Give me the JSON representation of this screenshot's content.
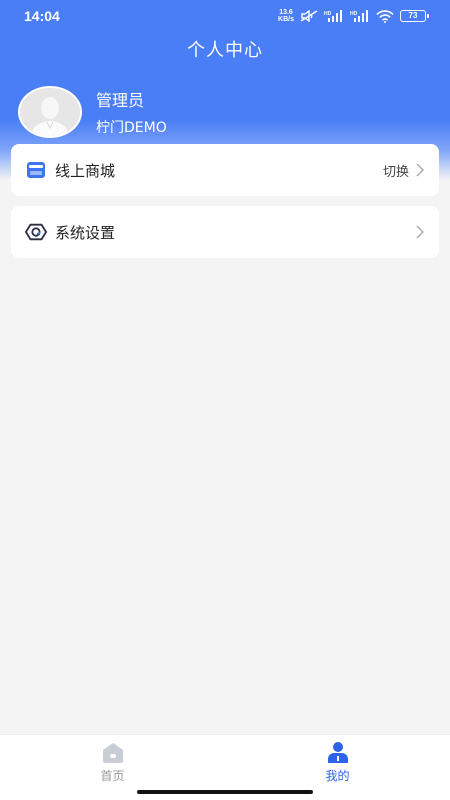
{
  "status_bar": {
    "time": "14:04",
    "net_speed_value": "13.6",
    "net_speed_unit": "KB/s",
    "battery": "73",
    "icons": [
      "mute-icon",
      "hd-signal-icon",
      "hd-signal-icon",
      "wifi-icon",
      "battery-icon"
    ]
  },
  "header": {
    "title": "个人中心"
  },
  "profile": {
    "name": "管理员",
    "subtitle": "柠门DEMO",
    "avatar_icon": "user-avatar-icon"
  },
  "menu": {
    "items": [
      {
        "label": "线上商城",
        "right_text": "切换",
        "icon": "store-icon"
      },
      {
        "label": "系统设置",
        "right_text": "",
        "icon": "settings-icon"
      }
    ]
  },
  "tabbar": {
    "tabs": [
      {
        "label": "首页",
        "icon": "home-icon",
        "active": false
      },
      {
        "label": "我的",
        "icon": "user-icon",
        "active": true
      }
    ]
  },
  "colors": {
    "primary": "#4a7ef6",
    "active_tab": "#2f63e8",
    "inactive_tab": "#999999",
    "background": "#f4f4f4"
  }
}
